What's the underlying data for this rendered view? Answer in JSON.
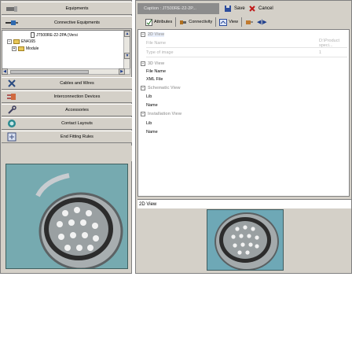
{
  "colors": {
    "panel_bg": "#d4d0c8",
    "caption_bg": "#8c8c8c",
    "section_header": "#a8a8a8",
    "photo_bg": "#76aab0"
  },
  "nav": {
    "equipments": "Equipments",
    "connective_equipments": "Connective Equipments",
    "cables_wires": "Cables and Wires",
    "interconnection_devices": "Interconnection Devices",
    "accessories": "Accessories",
    "contact_layouts": "Contact Layouts",
    "end_fitting_rules": "End Fitting Rules"
  },
  "tree": {
    "items": [
      {
        "plus": "",
        "label": "JT500RE-22-2PA (Versi"
      },
      {
        "plus": "−",
        "label": "EN4165"
      },
      {
        "plus": "+",
        "label": "Module"
      }
    ]
  },
  "toolbar": {
    "caption": "Caption : JT500RE-22-2P...",
    "save": "Save",
    "cancel": "Cancel",
    "attributes": "Attributes",
    "connectivity": "Connectivity",
    "view": "View"
  },
  "properties": {
    "sections": {
      "2d_view": "2D View",
      "3d_view": "3D View",
      "schematic_view": "Schematic View",
      "installation_view": "Installation View"
    },
    "file_name": "File Name",
    "file_name_value": "D:\\Product speci...",
    "type_of_image": "Type of image",
    "type_of_image_value": "1",
    "3d_file_name": "File Name",
    "xml_file": "XML File",
    "schematic_lib": "Lib",
    "schematic_name": "Name",
    "installation_lib": "Lib",
    "installation_name": "Name"
  },
  "view_panel": {
    "title": "2D View"
  }
}
